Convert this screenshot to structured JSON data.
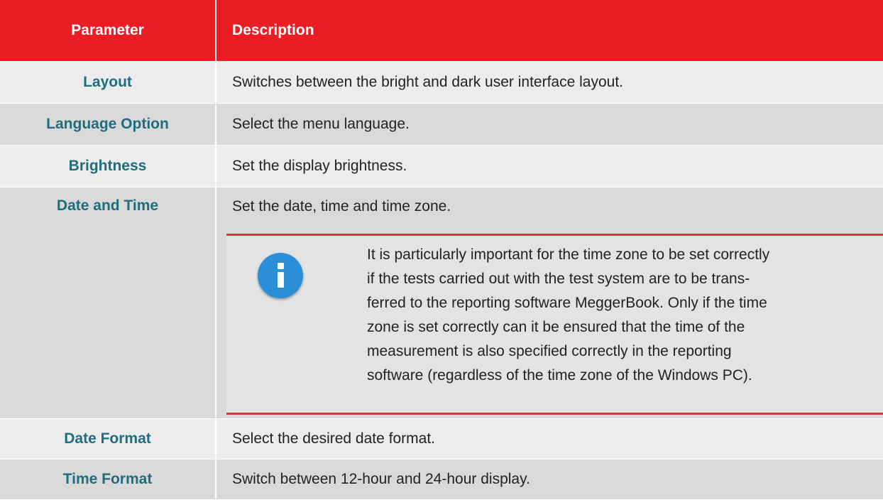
{
  "header": {
    "parameter": "Parameter",
    "description": "Description"
  },
  "rows": [
    {
      "parameter": "Layout",
      "description": "Switches between the bright and dark user interface layout."
    },
    {
      "parameter": "Language Option",
      "description": "Select the menu language."
    },
    {
      "parameter": "Brightness",
      "description": "Set the display brightness."
    },
    {
      "parameter": "Date and Time",
      "description": "Set the date, time and time zone.",
      "note": {
        "icon": "info-icon",
        "lines": [
          "It is particularly important for the time zone to be set correctly",
          "if the tests carried out with the test system are to be trans-",
          "ferred to the reporting software MeggerBook. Only if the time",
          "zone is set correctly can it be ensured that the time of the",
          "measurement is also specified correctly in the reporting",
          "software (regardless of the time zone of the Windows PC)."
        ]
      }
    },
    {
      "parameter": "Date Format",
      "description": "Select the desired date format."
    },
    {
      "parameter": "Time Format",
      "description": "Switch between 12-hour and 24-hour display."
    }
  ],
  "colors": {
    "header_bg": "#ec1c24",
    "param_text": "#1e6e7e",
    "row_light": "#ececec",
    "row_dark": "#d9d9d9",
    "note_rule": "#e0313a",
    "info_icon": "#2a8fd6"
  }
}
